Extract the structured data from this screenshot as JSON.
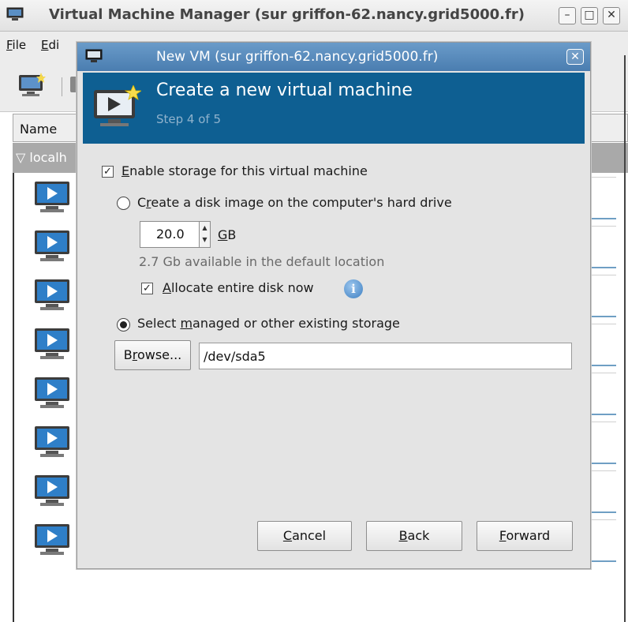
{
  "main_window": {
    "title": "Virtual Machine Manager (sur griffon-62.nancy.grid5000.fr)",
    "controls": {
      "minimize": "–",
      "maximize": "□",
      "close": "✕"
    },
    "menu": [
      {
        "mnemonic": "F",
        "rest": "ile"
      },
      {
        "mnemonic": "E",
        "rest": "di"
      }
    ],
    "list_header": "Name",
    "host_row": "localh",
    "vm_count": 8
  },
  "dialog": {
    "title": "New VM (sur griffon-62.nancy.grid5000.fr)",
    "close_glyph": "✕",
    "header_title": "Create a new virtual machine",
    "header_step": "Step 4 of 5",
    "enable_storage": {
      "checked": true,
      "mnemonic": "E",
      "rest": "nable storage for this virtual machine"
    },
    "create_disk": {
      "selected": false,
      "pre": "C",
      "mnemonic": "r",
      "rest": "eate a disk image on the computer's hard drive"
    },
    "size": {
      "value": "20.0",
      "unit_mnemonic": "G",
      "unit_rest": "B"
    },
    "available_text": "2.7 Gb available in the default location",
    "allocate": {
      "checked": true,
      "mnemonic": "A",
      "rest": "llocate entire disk now"
    },
    "select_storage": {
      "selected": true,
      "pre": "Select ",
      "mnemonic": "m",
      "rest": "anaged or other existing storage"
    },
    "browse": {
      "pre": "B",
      "mnemonic": "r",
      "rest": "owse..."
    },
    "path_value": "/dev/sda5",
    "buttons": {
      "cancel": {
        "mnemonic": "C",
        "rest": "ancel"
      },
      "back": {
        "mnemonic": "B",
        "rest": "ack"
      },
      "forward": {
        "mnemonic": "F",
        "rest": "orward"
      }
    }
  },
  "colors": {
    "title_gradient_top": "#6a9bc9",
    "title_gradient_bottom": "#4a7db0",
    "header_band": "#0e5f92",
    "host_row": "#a9a9a9",
    "info_blue": "#3d7fc1"
  }
}
